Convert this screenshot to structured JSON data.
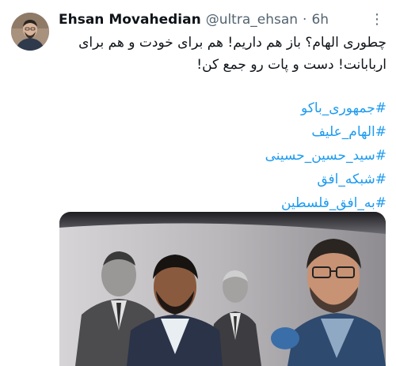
{
  "author": {
    "name": "Ehsan Movahedian",
    "handle": "@ultra_ehsan",
    "separator": "·",
    "time": "6h"
  },
  "tweet": {
    "lines": [
      "چطوری الهام؟ باز هم داریم! هم برای خودت و هم برای",
      "اربابانت! دست و پات رو جمع کن!"
    ],
    "hashtags": [
      "#جمهوری_باکو",
      "#الهام_علیف",
      "#سید_حسین_حسینی",
      "#شبکه_افق",
      "#به_افق_فلسطین"
    ]
  },
  "icons": {
    "more": "more-dots-icon"
  },
  "colors": {
    "link": "#1d9bf0",
    "text": "#0f1419",
    "muted": "#536471"
  }
}
